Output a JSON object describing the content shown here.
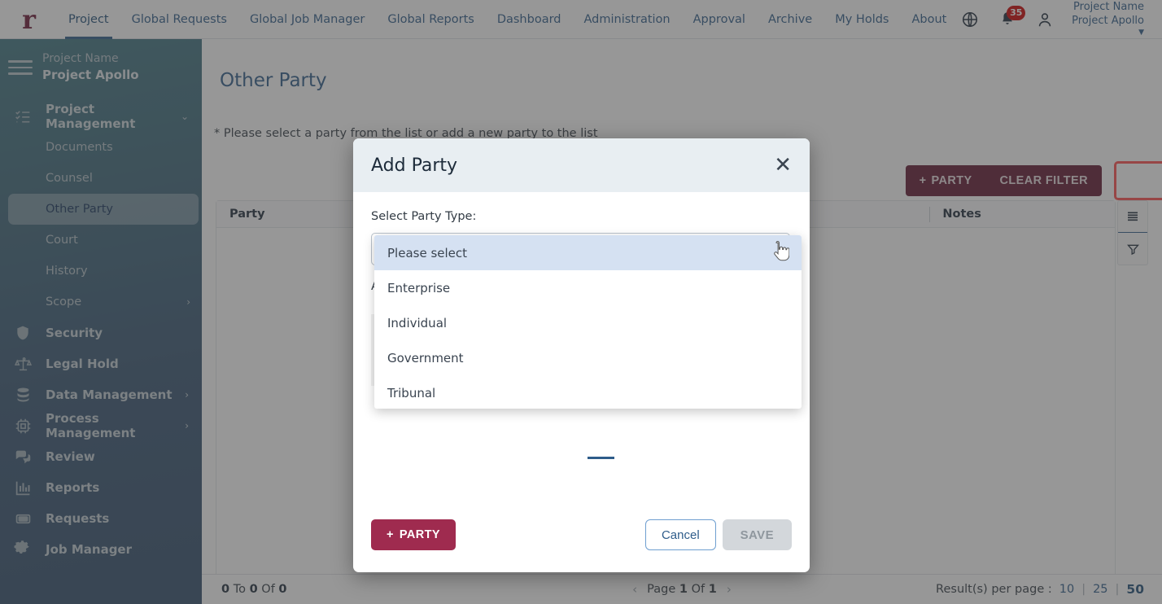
{
  "topnav": {
    "logo": "r",
    "items": [
      {
        "label": "Project",
        "active": true
      },
      {
        "label": "Global Requests",
        "active": false
      },
      {
        "label": "Global Job Manager",
        "active": false
      },
      {
        "label": "Global Reports",
        "active": false
      },
      {
        "label": "Dashboard",
        "active": false
      },
      {
        "label": "Administration",
        "active": false
      },
      {
        "label": "Approval",
        "active": false
      },
      {
        "label": "Archive",
        "active": false
      },
      {
        "label": "My Holds",
        "active": false
      },
      {
        "label": "About",
        "active": false
      }
    ],
    "globe_icon": "globe-icon",
    "bell_icon": "bell-icon",
    "notification_count": "35",
    "user_icon": "user-icon",
    "project_label": "Project Name",
    "project_name": "Project Apollo"
  },
  "sidebar": {
    "menu_icon": "hamburger-icon",
    "project_label": "Project Name",
    "project_name": "Project Apollo",
    "group": {
      "label": "Project Management",
      "icon": "checklist-icon"
    },
    "subitems": [
      {
        "label": "Documents"
      },
      {
        "label": "Counsel"
      },
      {
        "label": "Other Party"
      },
      {
        "label": "Court"
      },
      {
        "label": "History"
      },
      {
        "label": "Scope"
      }
    ],
    "items": [
      {
        "label": "Security",
        "icon": "shield-icon"
      },
      {
        "label": "Legal Hold",
        "icon": "scales-icon"
      },
      {
        "label": "Data Management",
        "icon": "database-icon"
      },
      {
        "label": "Process Management",
        "icon": "chip-icon"
      },
      {
        "label": "Review",
        "icon": "comments-icon"
      },
      {
        "label": "Reports",
        "icon": "bar-chart-icon"
      },
      {
        "label": "Requests",
        "icon": "ticket-icon"
      },
      {
        "label": "Job Manager",
        "icon": "gear-icon"
      }
    ]
  },
  "page": {
    "title": "Other Party",
    "hint_star": "*",
    "hint": "Please select a party from the list or add a new party to the list",
    "add_party_button": "PARTY",
    "clear_filter_button": "CLEAR FILTER",
    "columns": [
      "Party",
      "Notes"
    ],
    "rail": {
      "list_icon": "list-view-icon",
      "filter_icon": "filter-icon"
    }
  },
  "footer": {
    "range": "0 To 0 Of 0",
    "range_from": "0",
    "range_to": "0",
    "range_total": "0",
    "page_word": "Page",
    "page_current": "1",
    "page_of": "Of",
    "page_total": "1",
    "prev_icon": "chevron-left-icon",
    "next_icon": "chevron-right-icon",
    "per_page_label": "Result(s) per page :",
    "per_page_options": [
      "10",
      "25",
      "50"
    ],
    "per_page_selected": "50"
  },
  "modal": {
    "title": "Add Party",
    "close_icon": "close-icon",
    "select_label": "Select Party Type:",
    "second_label": "A",
    "add_party_button": "PARTY",
    "cancel_button": "Cancel",
    "save_button": "SAVE",
    "dropdown": {
      "options": [
        {
          "label": "Please select",
          "highlighted": true
        },
        {
          "label": "Enterprise",
          "highlighted": false
        },
        {
          "label": "Individual",
          "highlighted": false
        },
        {
          "label": "Government",
          "highlighted": false
        },
        {
          "label": "Tribunal",
          "highlighted": false
        }
      ]
    }
  },
  "colors": {
    "brand_maroon": "#5f1430",
    "accent_blue": "#2e5c8a",
    "badge_red": "#cc0000",
    "highlight_ring": "#ff4d4d",
    "dropdown_highlight": "#d5e1f2"
  }
}
